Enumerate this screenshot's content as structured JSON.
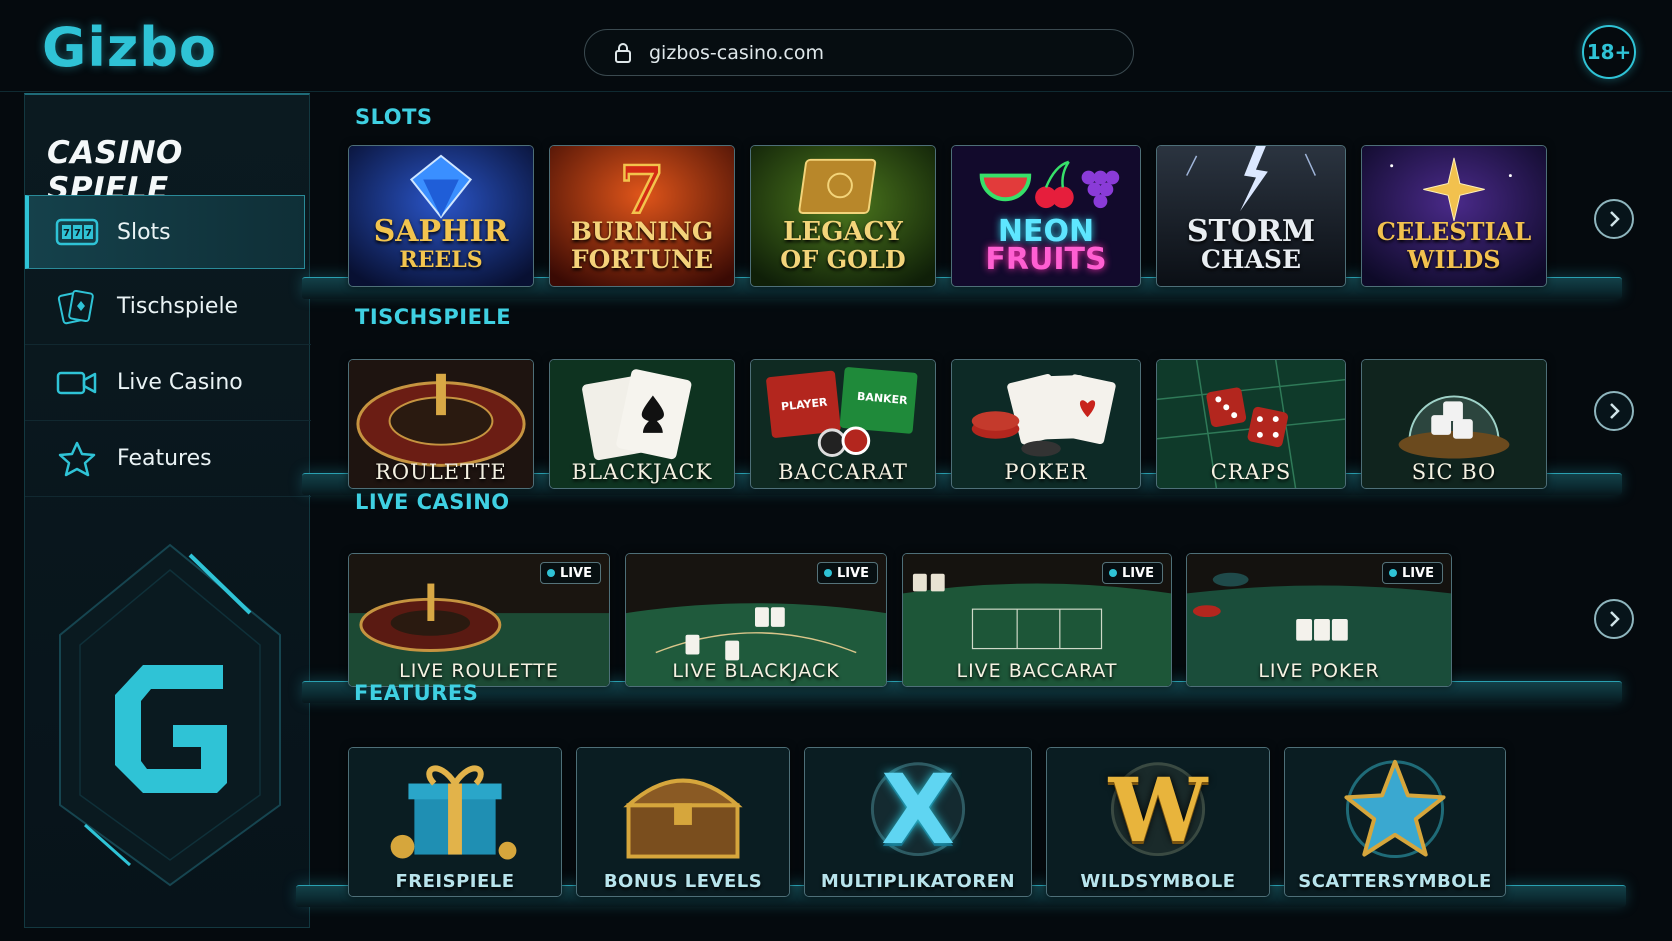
{
  "brand": {
    "logo_text": "Gizbo",
    "emblem_letter": "G",
    "accent": "#2fc3d6"
  },
  "url_bar": {
    "url": "gizbos-casino.com",
    "icon": "lock-icon"
  },
  "age_badge": "18+",
  "sidebar": {
    "title": "CASINO SPIELE",
    "items": [
      {
        "label": "Slots",
        "icon": "slot-machine-icon",
        "active": true
      },
      {
        "label": "Tischspiele",
        "icon": "cards-icon",
        "active": false
      },
      {
        "label": "Live Casino",
        "icon": "video-camera-icon",
        "active": false
      },
      {
        "label": "Features",
        "icon": "star-icon",
        "active": false
      }
    ]
  },
  "sections": {
    "slots": {
      "title": "SLOTS",
      "tiles": [
        {
          "line1": "SAPHIR",
          "line2": "REELS"
        },
        {
          "line1": "BURNING",
          "line2": "FORTUNE"
        },
        {
          "line1": "LEGACY",
          "line2": "OF GOLD"
        },
        {
          "line1": "NEON",
          "line2": "FRUITS"
        },
        {
          "line1": "STORM",
          "line2": "CHASE"
        },
        {
          "line1": "CELESTIAL",
          "line2": "WILDS"
        }
      ]
    },
    "table": {
      "title": "TISCHSPIELE",
      "tiles": [
        "ROULETTE",
        "BLACKJACK",
        "BACCARAT",
        "POKER",
        "CRAPS",
        "SIC BO"
      ],
      "baccarat_labels": {
        "player": "PLAYER",
        "banker": "BANKER"
      }
    },
    "live": {
      "title": "LIVE CASINO",
      "badge": "LIVE",
      "tiles": [
        "LIVE ROULETTE",
        "LIVE BLACKJACK",
        "LIVE BACCARAT",
        "LIVE POKER"
      ]
    },
    "features": {
      "title": "FEATURES",
      "tiles": [
        {
          "label": "FREISPIELE",
          "symbol": ""
        },
        {
          "label": "BONUS LEVELS",
          "symbol": ""
        },
        {
          "label": "MULTIPLIKATOREN",
          "symbol": "X"
        },
        {
          "label": "WILDSYMBOLE",
          "symbol": "W"
        },
        {
          "label": "SCATTERSYMBOLE",
          "symbol": ""
        }
      ]
    }
  }
}
